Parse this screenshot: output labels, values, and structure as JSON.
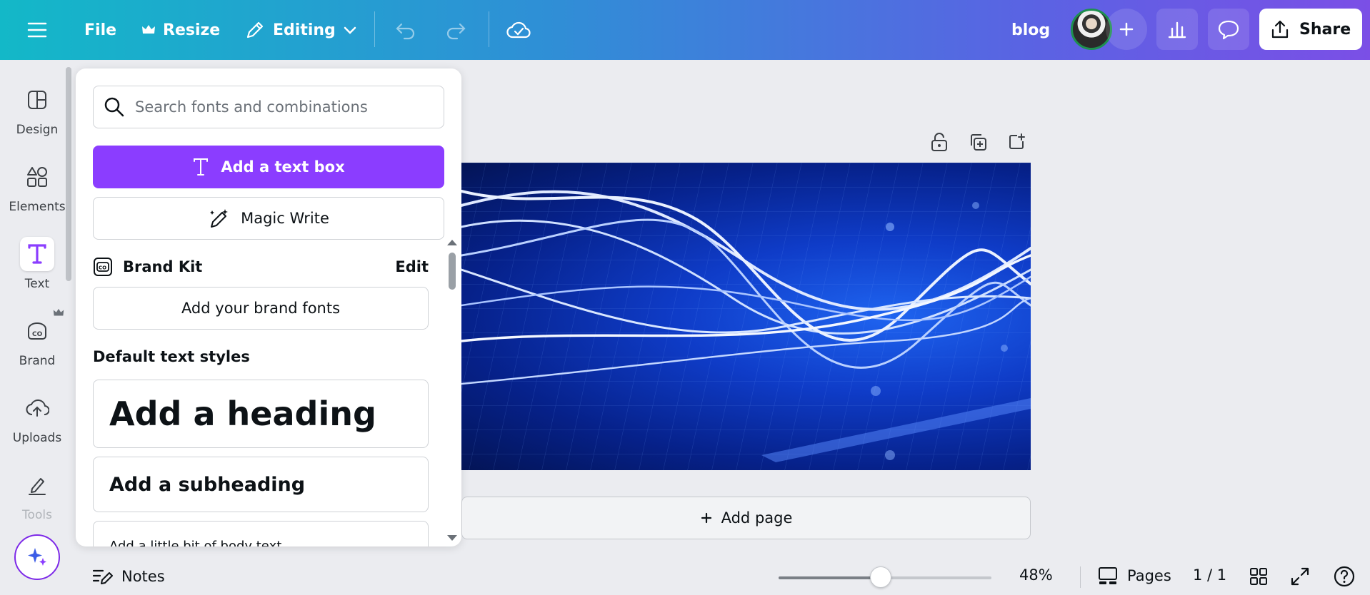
{
  "topbar": {
    "file_label": "File",
    "resize_label": "Resize",
    "editing_label": "Editing",
    "design_title": "blog",
    "share_label": "Share"
  },
  "rail": {
    "items": [
      {
        "label": "Design",
        "icon": "layout-icon"
      },
      {
        "label": "Elements",
        "icon": "shapes-icon"
      },
      {
        "label": "Text",
        "icon": "text-icon"
      },
      {
        "label": "Brand",
        "icon": "brand-icon"
      },
      {
        "label": "Uploads",
        "icon": "cloud-upload-icon"
      },
      {
        "label": "Tools",
        "icon": "pen-tools-icon"
      }
    ]
  },
  "panel": {
    "search_placeholder": "Search fonts and combinations",
    "add_text_box": "Add a text box",
    "magic_write": "Magic Write",
    "brand_kit": "Brand Kit",
    "brand_edit": "Edit",
    "add_brand_fonts": "Add your brand fonts",
    "default_styles_title": "Default text styles",
    "heading": "Add a heading",
    "subheading": "Add a subheading",
    "body": "Add a little bit of body text"
  },
  "canvas": {
    "add_page_label": "Add page"
  },
  "bottombar": {
    "notes_label": "Notes",
    "zoom_value": "48%",
    "zoom_fraction": 0.48,
    "pages_label": "Pages",
    "page_count": "1 / 1"
  },
  "colors": {
    "accent_purple": "#8b3dff",
    "topbar_start": "#13b8c8",
    "topbar_end": "#7b4fe6"
  }
}
